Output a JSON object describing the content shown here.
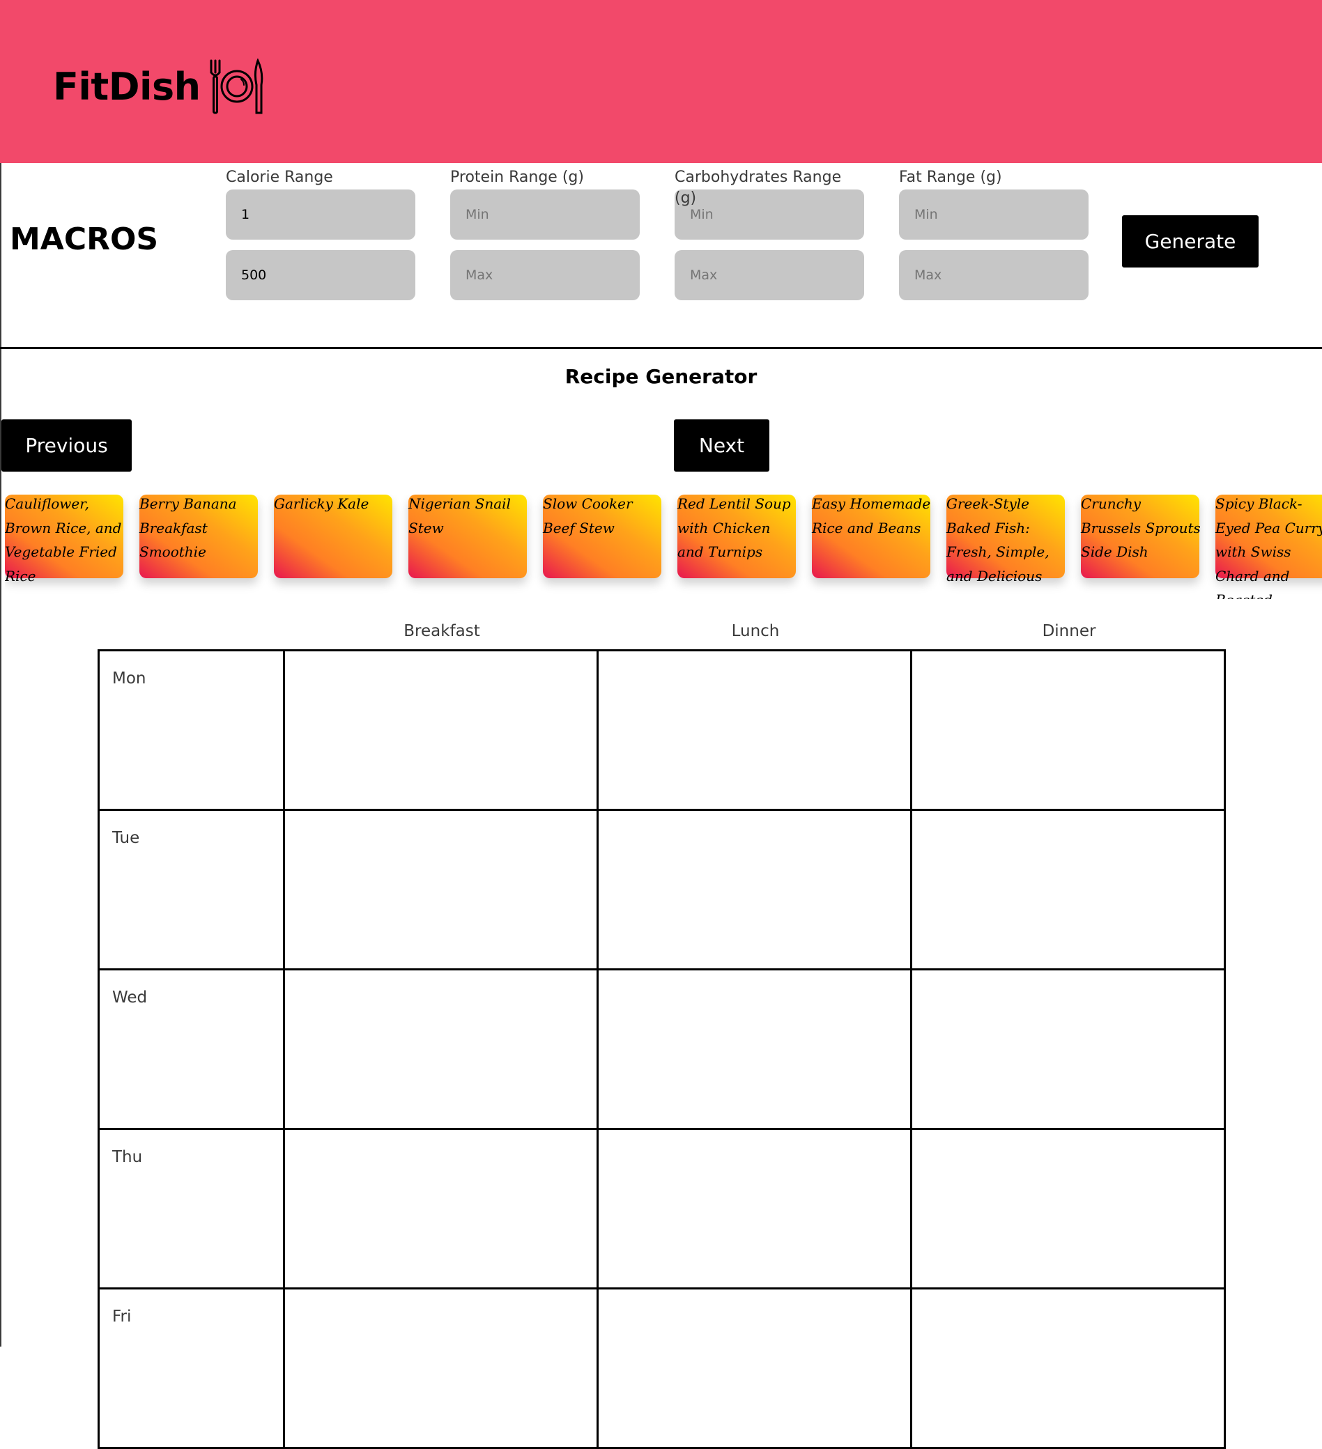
{
  "app": {
    "name": "FitDish",
    "logo_icon": "plate-fork-knife-icon",
    "brand_color": "#f2496a"
  },
  "macros": {
    "title": "MACROS",
    "fields": [
      {
        "label": "Calorie Range",
        "min_value": "1",
        "min_placeholder": "Min",
        "max_value": "500",
        "max_placeholder": "Max"
      },
      {
        "label": "Protein Range (g)",
        "min_value": "",
        "min_placeholder": "Min",
        "max_value": "",
        "max_placeholder": "Max"
      },
      {
        "label": "Carbohydrates Range (g)",
        "min_value": "",
        "min_placeholder": "Min",
        "max_value": "",
        "max_placeholder": "Max"
      },
      {
        "label": "Fat Range (g)",
        "min_value": "",
        "min_placeholder": "Min",
        "max_value": "",
        "max_placeholder": "Max"
      }
    ],
    "generate_label": "Generate"
  },
  "recipe_generator": {
    "title": "Recipe Generator",
    "previous_label": "Previous",
    "next_label": "Next",
    "recipes": [
      "Cauliflower, Brown Rice, and Vegetable Fried Rice",
      "Berry Banana Breakfast Smoothie",
      "Garlicky Kale",
      "Nigerian Snail Stew",
      "Slow Cooker Beef Stew",
      "Red Lentil Soup with Chicken and Turnips",
      "Easy Homemade Rice and Beans",
      "Greek-Style Baked Fish: Fresh, Simple, and Delicious",
      "Crunchy Brussels Sprouts Side Dish",
      "Spicy Black-Eyed Pea Curry with Swiss Chard and Roasted Eggplant"
    ]
  },
  "meal_plan": {
    "columns": [
      "Breakfast",
      "Lunch",
      "Dinner"
    ],
    "days": [
      "Mon",
      "Tue",
      "Wed",
      "Thu",
      "Fri"
    ]
  }
}
